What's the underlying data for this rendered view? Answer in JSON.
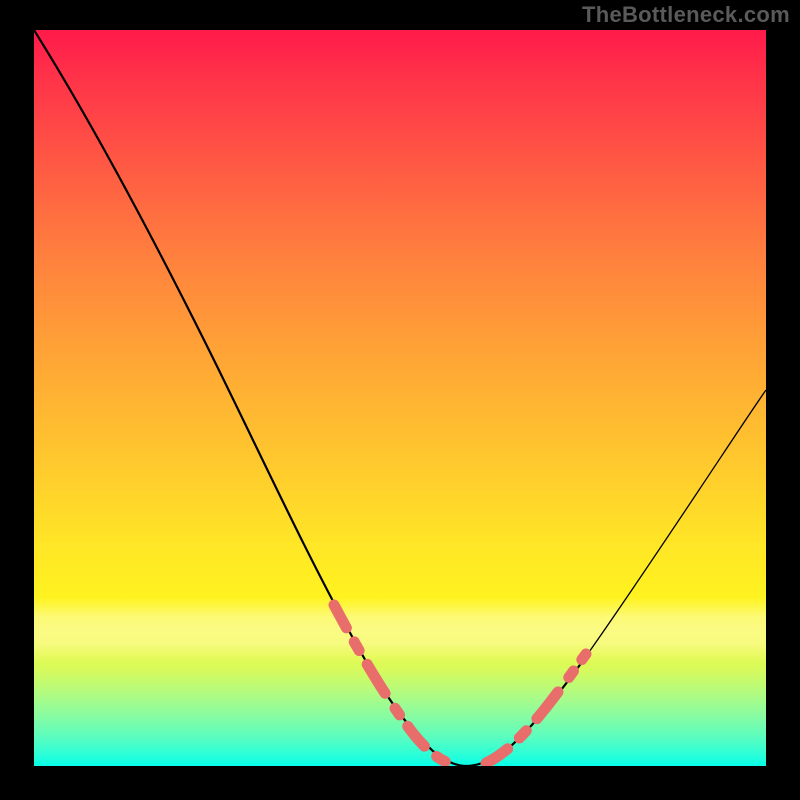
{
  "watermark": "TheBottleneck.com",
  "colors": {
    "background": "#000000",
    "gradient_top": "#ff1a4a",
    "gradient_mid": "#ffe626",
    "gradient_bottom": "#06ffe8",
    "curve": "#000000",
    "dash": "#e86d6b"
  },
  "chart_data": {
    "type": "line",
    "title": "",
    "xlabel": "",
    "ylabel": "",
    "xlim": [
      0,
      100
    ],
    "ylim": [
      0,
      100
    ],
    "grid": false,
    "annotations": [
      {
        "text": "TheBottleneck.com",
        "position": "top-right"
      }
    ],
    "series": [
      {
        "name": "bottleneck-curve",
        "note": "V-shaped curve; x in 0..100, y is estimated height from bottom (0) to top (100)",
        "x": [
          0,
          6,
          12,
          18,
          24,
          30,
          36,
          42,
          46,
          50,
          53,
          56,
          59,
          62,
          66,
          72,
          80,
          90,
          100
        ],
        "y": [
          100,
          88,
          77,
          66,
          55,
          44,
          33,
          22,
          14,
          7,
          3,
          1,
          0,
          1,
          4,
          10,
          20,
          35,
          50
        ]
      },
      {
        "name": "highlight-left-dash",
        "note": "pink dashed segment overlay on left descending limb near trough",
        "x": [
          40,
          43,
          46,
          49,
          52,
          55
        ],
        "y": [
          25,
          19,
          13,
          8,
          4,
          1
        ]
      },
      {
        "name": "highlight-right-dash",
        "note": "pink dashed segment overlay on right ascending limb near trough",
        "x": [
          60,
          63,
          66,
          69,
          72
        ],
        "y": [
          1,
          3,
          6,
          10,
          14
        ]
      }
    ]
  }
}
